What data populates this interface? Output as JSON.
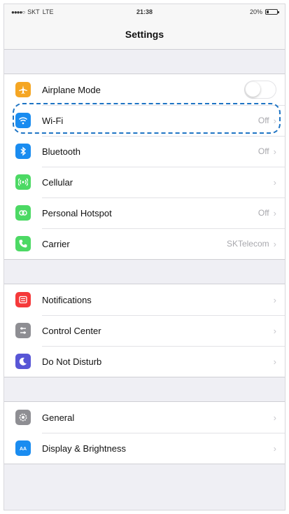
{
  "status_bar": {
    "carrier": "SKT",
    "network": "LTE",
    "time": "21:38",
    "battery": "20%",
    "battery_level": 0.2
  },
  "nav": {
    "title": "Settings"
  },
  "groups": [
    {
      "rows": [
        {
          "label": "Airplane Mode",
          "icon": "airplane-icon",
          "color": "#f5a623",
          "control": "toggle",
          "toggle_on": false
        },
        {
          "label": "Wi-Fi",
          "icon": "wifi-icon",
          "color": "#1a8cf0",
          "value": "Off"
        },
        {
          "label": "Bluetooth",
          "icon": "bluetooth-icon",
          "color": "#1a8cf0",
          "value": "Off"
        },
        {
          "label": "Cellular",
          "icon": "cellular-icon",
          "color": "#4cd964",
          "value": ""
        },
        {
          "label": "Personal Hotspot",
          "icon": "hotspot-icon",
          "color": "#4cd964",
          "value": "Off"
        },
        {
          "label": "Carrier",
          "icon": "phone-icon",
          "color": "#4cd964",
          "value": "SKTelecom"
        }
      ]
    },
    {
      "rows": [
        {
          "label": "Notifications",
          "icon": "notifications-icon",
          "color": "#f5393a",
          "value": ""
        },
        {
          "label": "Control Center",
          "icon": "control-center-icon",
          "color": "#8e8e93",
          "value": ""
        },
        {
          "label": "Do Not Disturb",
          "icon": "moon-icon",
          "color": "#5856d6",
          "value": ""
        }
      ]
    },
    {
      "rows": [
        {
          "label": "General",
          "icon": "gear-icon",
          "color": "#8e8e93",
          "value": ""
        },
        {
          "label": "Display & Brightness",
          "icon": "display-icon",
          "color": "#1a8cf0",
          "value": ""
        }
      ]
    }
  ],
  "highlight": {
    "target": "Wi-Fi",
    "color": "#1e74c4"
  }
}
